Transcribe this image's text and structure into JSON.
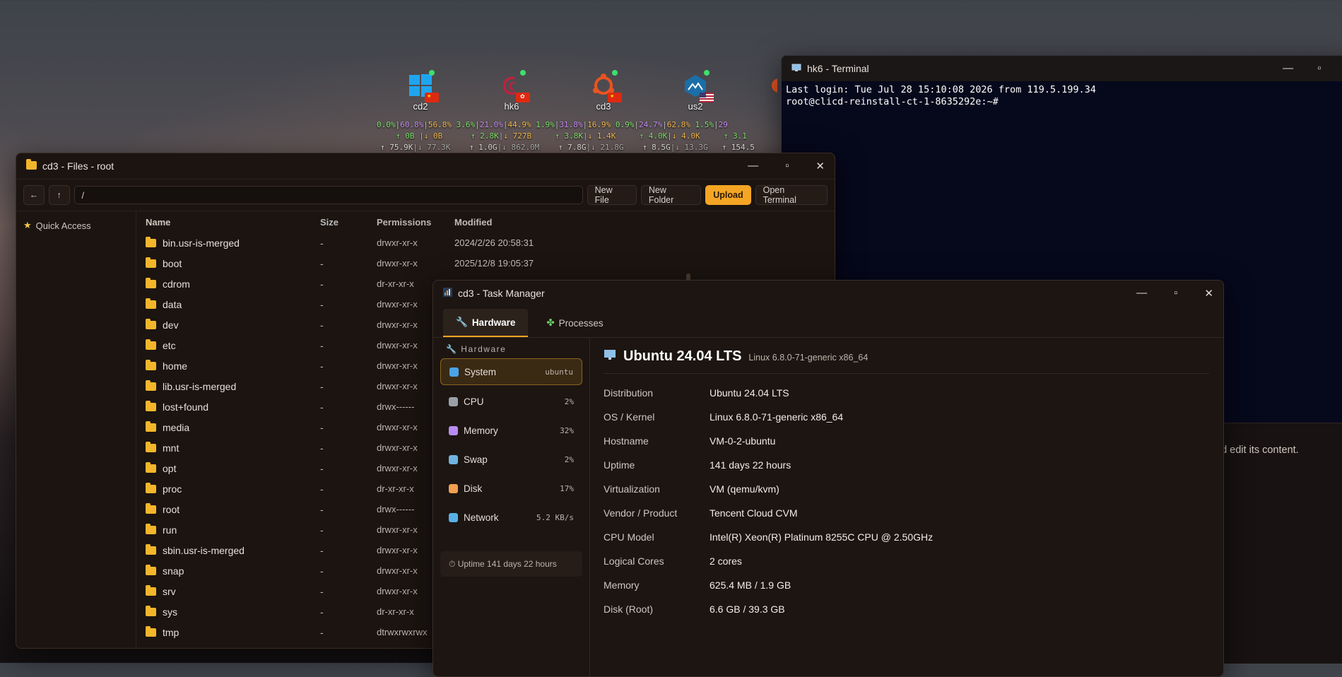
{
  "desktop": {
    "nodes": [
      {
        "name": "cd2",
        "flag": "cn"
      },
      {
        "name": "hk6",
        "flag": "hk"
      },
      {
        "name": "cd3",
        "flag": "cn"
      },
      {
        "name": "us2",
        "flag": "us"
      }
    ],
    "stats_row1": [
      {
        "cpu": "0.0%",
        "mem": "60.8%",
        "disk": "56.8%"
      },
      {
        "cpu": "3.6%",
        "mem": "21.0%",
        "disk": "44.9%"
      },
      {
        "cpu": "1.9%",
        "mem": "31.8%",
        "disk": "16.9%"
      },
      {
        "cpu": "0.9%",
        "mem": "24.7%",
        "disk": "62.8%"
      },
      {
        "cpu": "1.5%",
        "mem": "29"
      }
    ],
    "stats_row2": [
      {
        "up": "↑ 0B",
        "down": "↓ 0B"
      },
      {
        "up": "↑ 2.8K",
        "down": "↓ 727B"
      },
      {
        "up": "↑ 3.8K",
        "down": "↓ 1.4K"
      },
      {
        "up": "↑ 4.0K",
        "down": "↓ 4.0K"
      },
      {
        "up": "↑ 3.1"
      }
    ],
    "stats_row3": [
      {
        "up": "↑ 75.9K",
        "down": "↓ 77.3K"
      },
      {
        "up": "↑ 1.0G",
        "down": "↓ 862.0M"
      },
      {
        "up": "↑ 7.8G",
        "down": "↓ 21.8G"
      },
      {
        "up": "↑ 8.5G",
        "down": "↓ 13.3G"
      },
      {
        "up": "↑ 154.5"
      }
    ]
  },
  "terminal": {
    "title": "hk6 - Terminal",
    "lines": [
      "Last login: Tue Jul 28 15:10:08 2026 from 119.5.199.34",
      "root@clicd-reinstall-ct-1-8635292e:~#"
    ]
  },
  "hint_text": "nd edit its content.",
  "files": {
    "title": "cd3 - Files - root",
    "path": "/",
    "buttons": {
      "new_file": "New File",
      "new_folder": "New Folder",
      "upload": "Upload",
      "open_terminal": "Open Terminal"
    },
    "back": "←",
    "up": "↑",
    "quick_access": "Quick Access",
    "headers": {
      "name": "Name",
      "size": "Size",
      "permissions": "Permissions",
      "modified": "Modified"
    },
    "rows": [
      {
        "name": "bin.usr-is-merged",
        "size": "-",
        "perm": "drwxr-xr-x",
        "mod": "2024/2/26 20:58:31"
      },
      {
        "name": "boot",
        "size": "-",
        "perm": "drwxr-xr-x",
        "mod": "2025/12/8 19:05:37"
      },
      {
        "name": "cdrom",
        "size": "-",
        "perm": "dr-xr-xr-x",
        "mod": ""
      },
      {
        "name": "data",
        "size": "-",
        "perm": "drwxr-xr-x",
        "mod": ""
      },
      {
        "name": "dev",
        "size": "-",
        "perm": "drwxr-xr-x",
        "mod": ""
      },
      {
        "name": "etc",
        "size": "-",
        "perm": "drwxr-xr-x",
        "mod": ""
      },
      {
        "name": "home",
        "size": "-",
        "perm": "drwxr-xr-x",
        "mod": ""
      },
      {
        "name": "lib.usr-is-merged",
        "size": "-",
        "perm": "drwxr-xr-x",
        "mod": ""
      },
      {
        "name": "lost+found",
        "size": "-",
        "perm": "drwx------",
        "mod": ""
      },
      {
        "name": "media",
        "size": "-",
        "perm": "drwxr-xr-x",
        "mod": ""
      },
      {
        "name": "mnt",
        "size": "-",
        "perm": "drwxr-xr-x",
        "mod": ""
      },
      {
        "name": "opt",
        "size": "-",
        "perm": "drwxr-xr-x",
        "mod": ""
      },
      {
        "name": "proc",
        "size": "-",
        "perm": "dr-xr-xr-x",
        "mod": ""
      },
      {
        "name": "root",
        "size": "-",
        "perm": "drwx------",
        "mod": ""
      },
      {
        "name": "run",
        "size": "-",
        "perm": "drwxr-xr-x",
        "mod": ""
      },
      {
        "name": "sbin.usr-is-merged",
        "size": "-",
        "perm": "drwxr-xr-x",
        "mod": ""
      },
      {
        "name": "snap",
        "size": "-",
        "perm": "drwxr-xr-x",
        "mod": ""
      },
      {
        "name": "srv",
        "size": "-",
        "perm": "drwxr-xr-x",
        "mod": ""
      },
      {
        "name": "sys",
        "size": "-",
        "perm": "dr-xr-xr-x",
        "mod": ""
      },
      {
        "name": "tmp",
        "size": "-",
        "perm": "dtrwxrwxrwx",
        "mod": ""
      }
    ]
  },
  "taskmgr": {
    "title": "cd3 - Task Manager",
    "tabs": {
      "hardware": "Hardware",
      "processes": "Processes"
    },
    "section": "Hardware",
    "items": [
      {
        "label": "System",
        "value": "ubuntu",
        "color": "#4aa3e8"
      },
      {
        "label": "CPU",
        "value": "2%",
        "color": "#9aa0a8"
      },
      {
        "label": "Memory",
        "value": "32%",
        "color": "#b78cf0"
      },
      {
        "label": "Swap",
        "value": "2%",
        "color": "#6fb3e0"
      },
      {
        "label": "Disk",
        "value": "17%",
        "color": "#f0a050"
      },
      {
        "label": "Network",
        "value": "5.2 KB/s",
        "color": "#58b0e8"
      }
    ],
    "uptime": "⏱ Uptime 141 days 22 hours",
    "os_name": "Ubuntu 24.04 LTS",
    "os_kernel": "Linux 6.8.0-71-generic x86_64",
    "details": [
      {
        "k": "Distribution",
        "v": "Ubuntu 24.04 LTS"
      },
      {
        "k": "OS / Kernel",
        "v": "Linux 6.8.0-71-generic x86_64"
      },
      {
        "k": "Hostname",
        "v": "VM-0-2-ubuntu"
      },
      {
        "k": "Uptime",
        "v": "141 days 22 hours"
      },
      {
        "k": "Virtualization",
        "v": "VM (qemu/kvm)"
      },
      {
        "k": "Vendor / Product",
        "v": "Tencent Cloud CVM"
      },
      {
        "k": "CPU Model",
        "v": "Intel(R) Xeon(R) Platinum 8255C CPU @ 2.50GHz"
      },
      {
        "k": "Logical Cores",
        "v": "2 cores"
      },
      {
        "k": "Memory",
        "v": "625.4 MB / 1.9 GB"
      },
      {
        "k": "Disk (Root)",
        "v": "6.6 GB / 39.3 GB"
      }
    ]
  },
  "window_controls": {
    "min": "—",
    "max": "▫",
    "close": "✕"
  },
  "colors": {
    "accent": "#f5a524",
    "terminal_bg": "#06081c",
    "folder": "#f3b62b"
  }
}
